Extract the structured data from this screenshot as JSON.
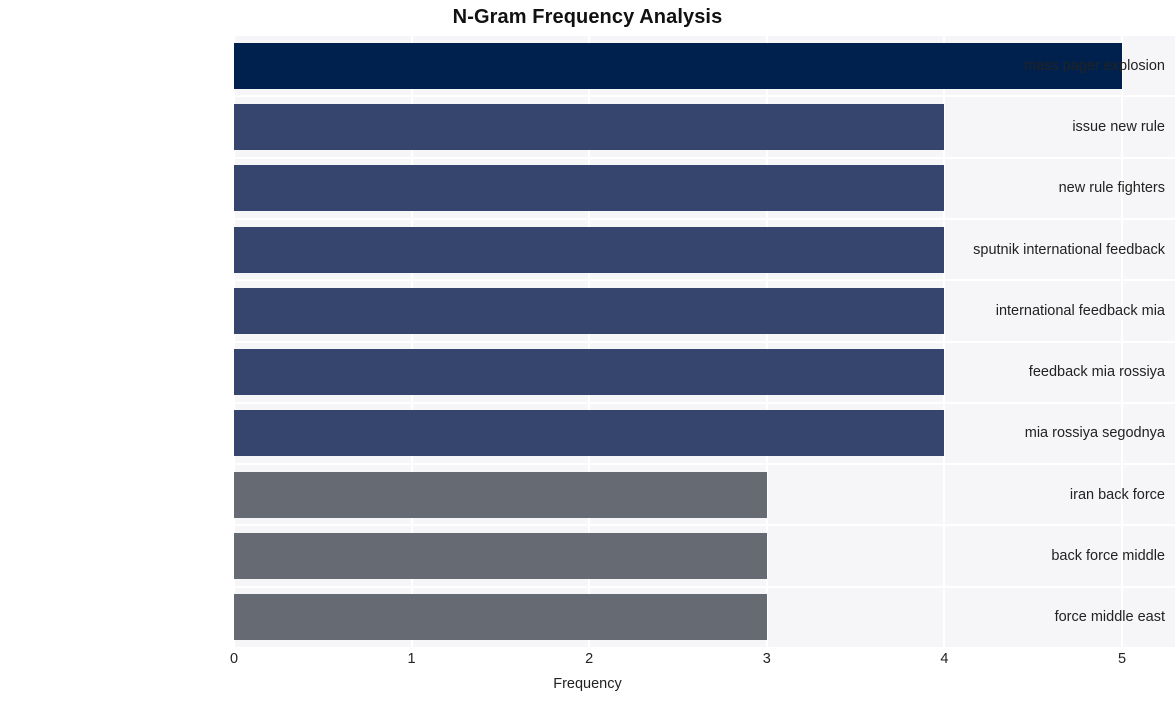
{
  "chart_data": {
    "type": "bar",
    "orientation": "horizontal",
    "title": "N-Gram Frequency Analysis",
    "xlabel": "Frequency",
    "ylabel": "",
    "categories": [
      "mass pager explosion",
      "issue new rule",
      "new rule fighters",
      "sputnik international feedback",
      "international feedback mia",
      "feedback mia rossiya",
      "mia rossiya segodnya",
      "iran back force",
      "back force middle",
      "force middle east"
    ],
    "values": [
      5,
      4,
      4,
      4,
      4,
      4,
      4,
      3,
      3,
      3
    ],
    "bar_colors": [
      "#00214d",
      "#35456e",
      "#35456e",
      "#35456e",
      "#35456e",
      "#35456e",
      "#35456e",
      "#666a73",
      "#666a73",
      "#666a73"
    ],
    "xlim": [
      0,
      5
    ],
    "xticks": [
      0,
      1,
      2,
      3,
      4,
      5
    ],
    "xtick_labels": [
      "0",
      "1",
      "2",
      "3",
      "4",
      "5"
    ],
    "grid": true,
    "grid_color": "#ffffff",
    "legend": null,
    "plot_background": "#f6f6f8",
    "figure_background": "#ffffff"
  }
}
